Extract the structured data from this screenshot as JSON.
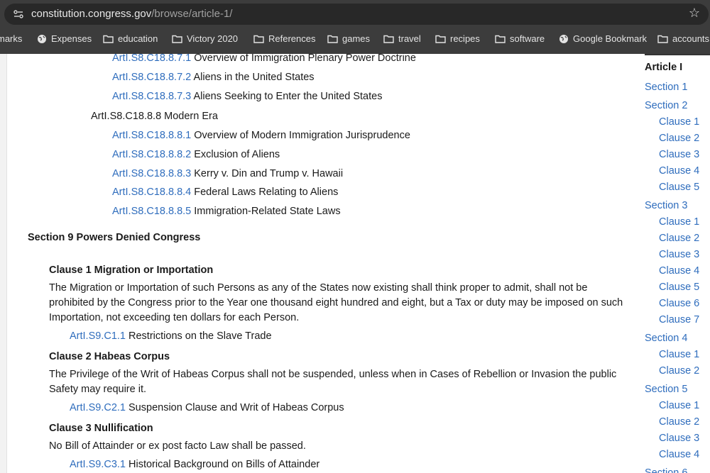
{
  "browser": {
    "url_host": "constitution.congress.gov",
    "url_path": "/browse/article-1/",
    "bookmarks": [
      {
        "label": "marks",
        "icon": "none"
      },
      {
        "label": "Expenses",
        "icon": "globe-icon"
      },
      {
        "label": "education",
        "icon": "folder-icon"
      },
      {
        "label": "Victory 2020",
        "icon": "folder-icon"
      },
      {
        "label": "References",
        "icon": "folder-icon"
      },
      {
        "label": "games",
        "icon": "folder-icon"
      },
      {
        "label": "travel",
        "icon": "folder-icon"
      },
      {
        "label": "recipes",
        "icon": "folder-icon"
      },
      {
        "label": "software",
        "icon": "folder-icon"
      },
      {
        "label": "Google Bookmark",
        "icon": "globe-icon"
      },
      {
        "label": "accounts",
        "icon": "folder-icon"
      }
    ]
  },
  "content": {
    "rows": [
      {
        "code": "ArtI.S8.C18.8.7.1",
        "text": "Overview of Immigration Plenary Power Doctrine"
      },
      {
        "code": "ArtI.S8.C18.8.7.2",
        "text": "Aliens in the United States"
      },
      {
        "code": "ArtI.S8.C18.8.7.3",
        "text": "Aliens Seeking to Enter the United States"
      },
      {
        "code": "",
        "text": "ArtI.S8.C18.8.8 Modern Era"
      },
      {
        "code": "ArtI.S8.C18.8.8.1",
        "text": "Overview of Modern Immigration Jurisprudence"
      },
      {
        "code": "ArtI.S8.C18.8.8.2",
        "text": "Exclusion of Aliens"
      },
      {
        "code": "ArtI.S8.C18.8.8.3",
        "text": "Kerry v. Din and Trump v. Hawaii"
      },
      {
        "code": "ArtI.S8.C18.8.8.4",
        "text": "Federal Laws Relating to Aliens"
      },
      {
        "code": "ArtI.S8.C18.8.8.5",
        "text": "Immigration-Related State Laws"
      }
    ],
    "section9_heading": "Section 9 Powers Denied Congress",
    "clause1": {
      "heading": "Clause 1 Migration or Importation",
      "text": "The Migration or Importation of such Persons as any of the States now existing shall think proper to admit, shall not be prohibited by the Congress prior to the Year one thousand eight hundred and eight, but a Tax or duty may be imposed on such Importation, not exceeding ten dollars for each Person.",
      "ref_code": "ArtI.S9.C1.1",
      "ref_text": "Restrictions on the Slave Trade"
    },
    "clause2": {
      "heading": "Clause 2 Habeas Corpus",
      "text": "The Privilege of the Writ of Habeas Corpus shall not be suspended, unless when in Cases of Rebellion or Invasion the public Safety may require it.",
      "ref_code": "ArtI.S9.C2.1",
      "ref_text": "Suspension Clause and Writ of Habeas Corpus"
    },
    "clause3": {
      "heading": "Clause 3 Nullification",
      "text": "No Bill of Attainder or ex post facto Law shall be passed.",
      "ref_code": "ArtI.S9.C3.1",
      "ref_text": "Historical Background on Bills of Attainder"
    }
  },
  "sidebar": {
    "title": "Article I",
    "items": [
      {
        "label": "Section 1",
        "level": 1
      },
      {
        "label": "Section 2",
        "level": 1
      },
      {
        "label": "Clause 1",
        "level": 2
      },
      {
        "label": "Clause 2",
        "level": 2
      },
      {
        "label": "Clause 3",
        "level": 2
      },
      {
        "label": "Clause 4",
        "level": 2
      },
      {
        "label": "Clause 5",
        "level": 2
      },
      {
        "label": "Section 3",
        "level": 1
      },
      {
        "label": "Clause 1",
        "level": 2
      },
      {
        "label": "Clause 2",
        "level": 2
      },
      {
        "label": "Clause 3",
        "level": 2
      },
      {
        "label": "Clause 4",
        "level": 2
      },
      {
        "label": "Clause 5",
        "level": 2
      },
      {
        "label": "Clause 6",
        "level": 2
      },
      {
        "label": "Clause 7",
        "level": 2
      },
      {
        "label": "Section 4",
        "level": 1
      },
      {
        "label": "Clause 1",
        "level": 2
      },
      {
        "label": "Clause 2",
        "level": 2
      },
      {
        "label": "Section 5",
        "level": 1
      },
      {
        "label": "Clause 1",
        "level": 2
      },
      {
        "label": "Clause 2",
        "level": 2
      },
      {
        "label": "Clause 3",
        "level": 2
      },
      {
        "label": "Clause 4",
        "level": 2
      },
      {
        "label": "Section 6",
        "level": 1
      }
    ]
  }
}
